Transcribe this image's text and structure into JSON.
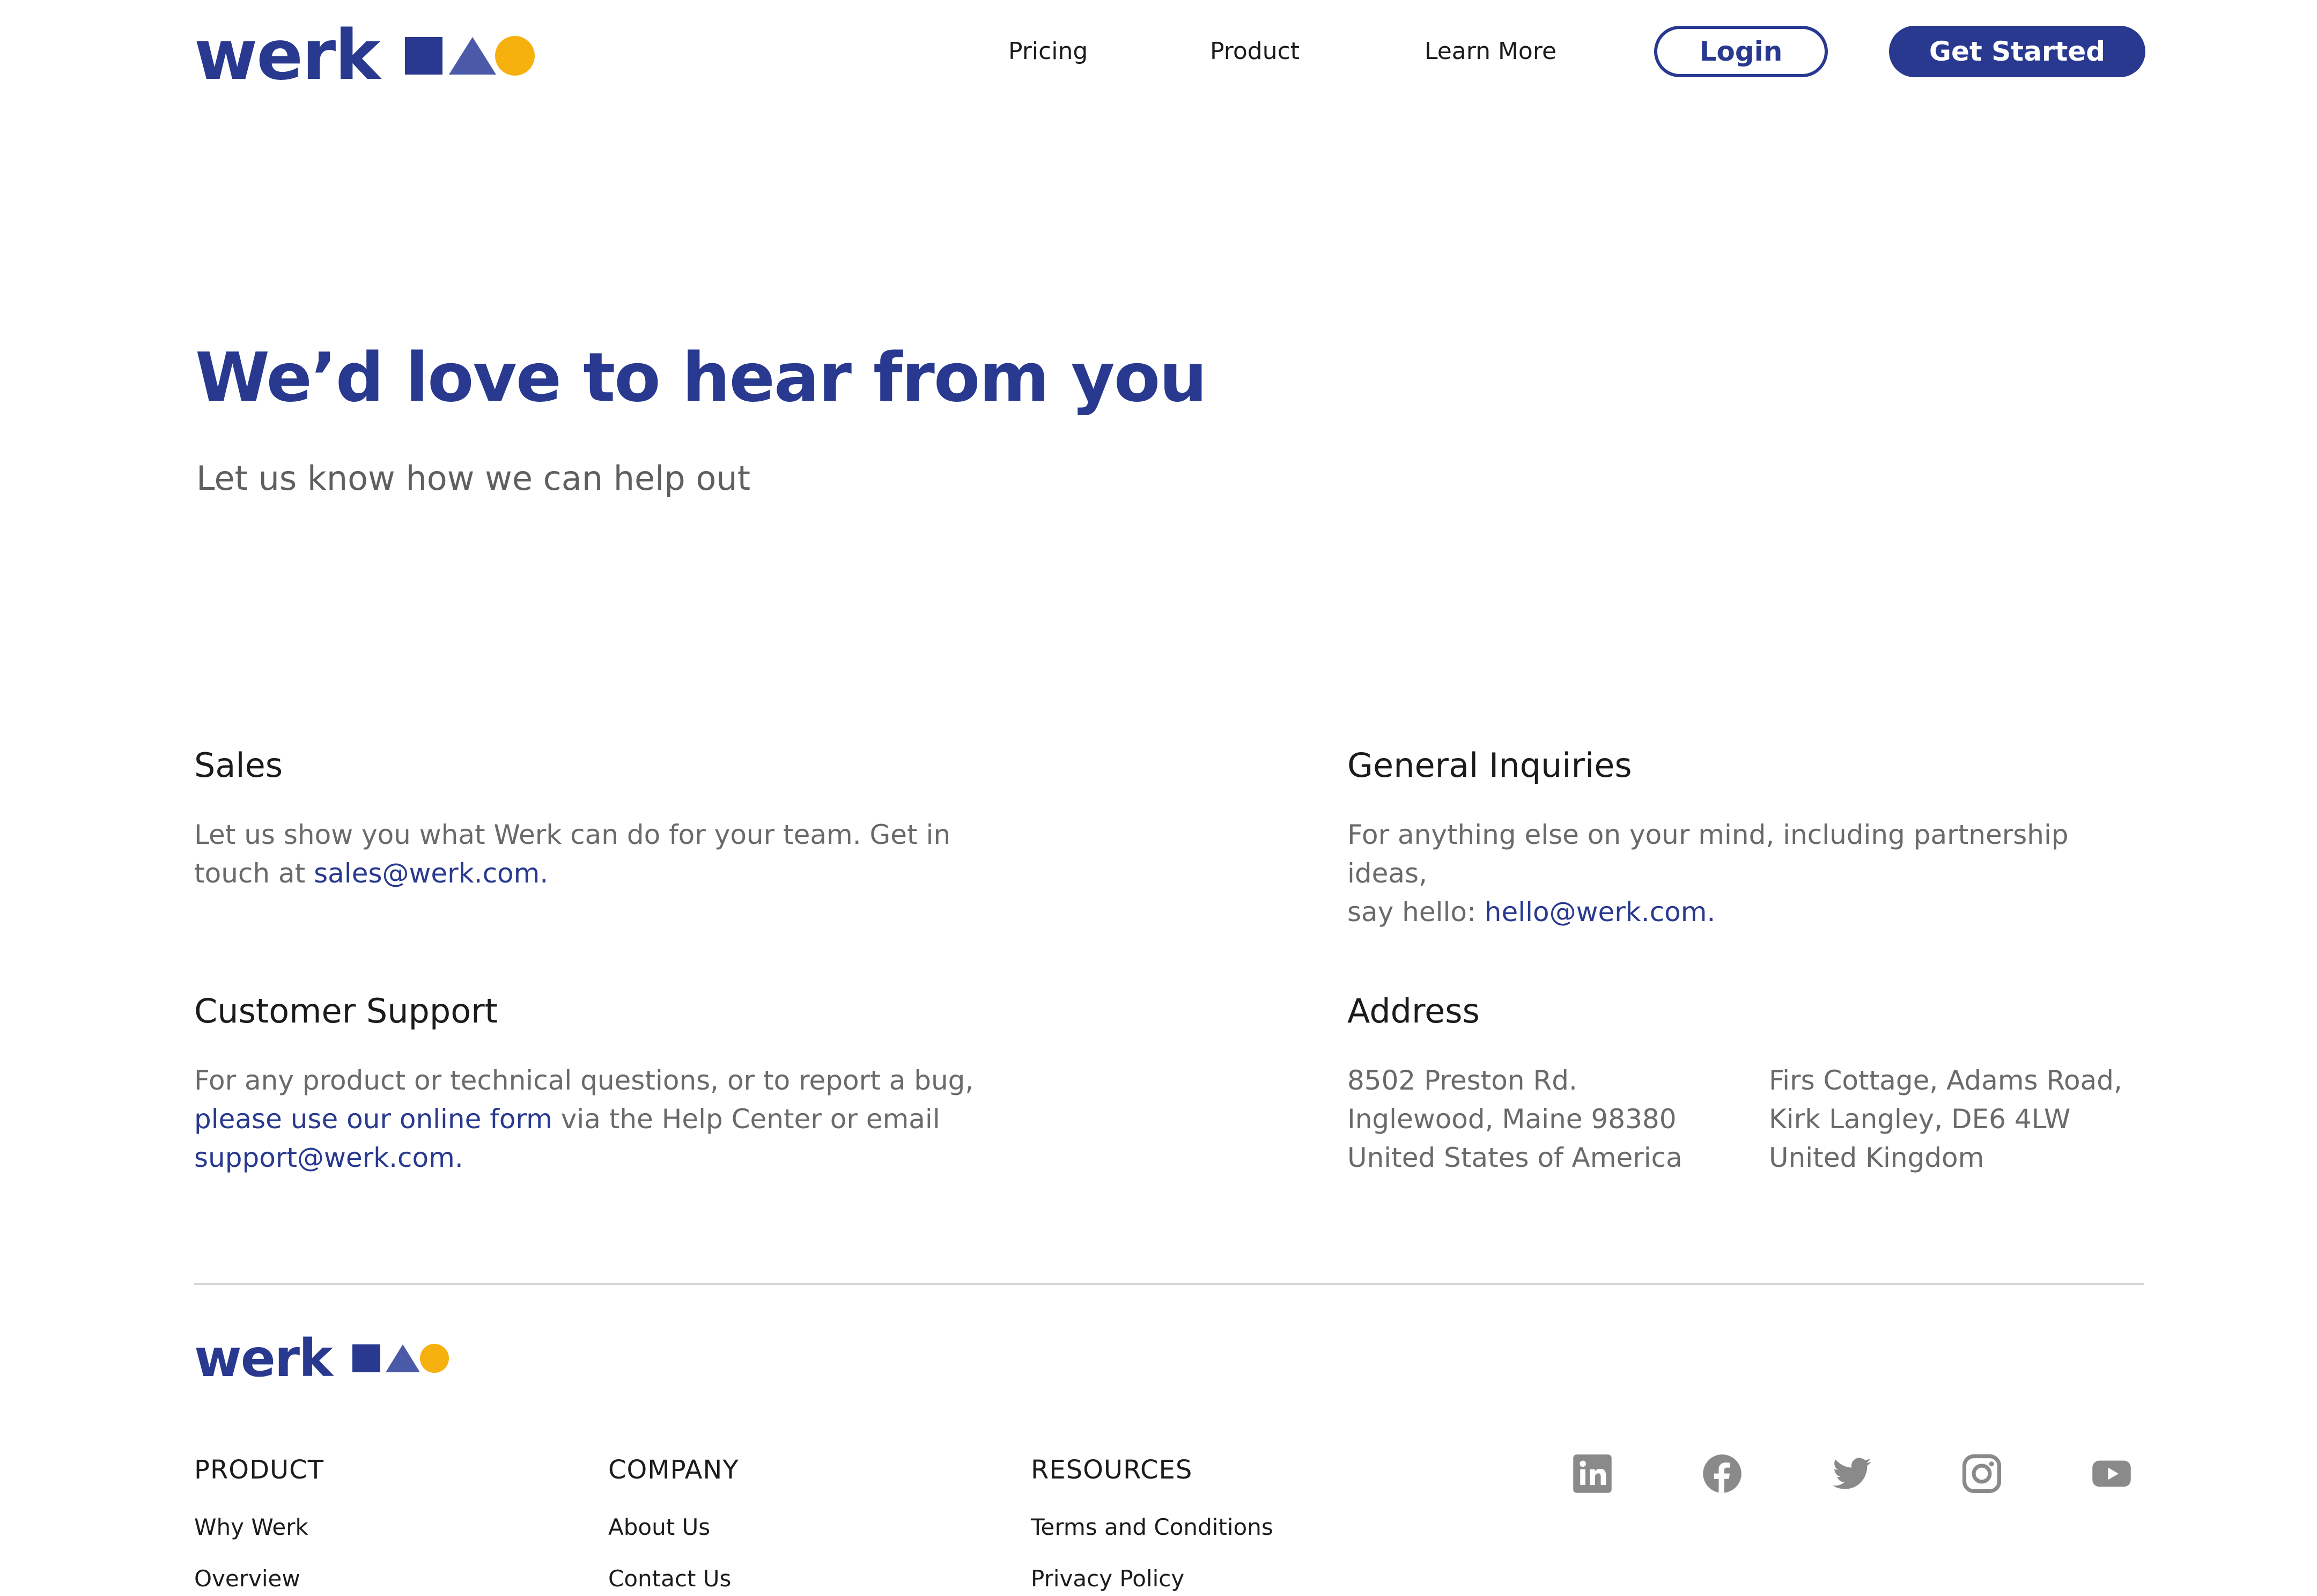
{
  "header": {
    "brand": "werk",
    "nav": [
      "Pricing",
      "Product",
      "Learn More"
    ],
    "login_label": "Login",
    "cta_label": "Get Started"
  },
  "hero": {
    "title": "We’d love to hear from you",
    "subtitle": "Let us know how we can help out"
  },
  "sections": {
    "sales": {
      "title": "Sales",
      "line1": "Let us show you what Werk can do for your team. Get in",
      "line2_prefix": "touch at ",
      "email": "sales@werk.com."
    },
    "general": {
      "title": "General Inquiries",
      "line1": "For anything else on your mind, including partnership ideas,",
      "line2_prefix": "say hello: ",
      "email": "hello@werk.com."
    },
    "support": {
      "title": "Customer Support",
      "line1": "For any product or technical questions, or to report a bug,",
      "form_link": "please use our online form",
      "line2_suffix": " via the Help Center or email",
      "email": "support@werk.com."
    },
    "address": {
      "title": "Address",
      "us": [
        "8502 Preston Rd.",
        "Inglewood, Maine 98380",
        "United States of America"
      ],
      "uk": [
        "Firs Cottage, Adams Road,",
        "Kirk Langley, DE6 4LW",
        "United Kingdom"
      ]
    }
  },
  "footer": {
    "brand": "werk",
    "columns": [
      {
        "title": "PRODUCT",
        "links": [
          "Why Werk",
          "Overview"
        ]
      },
      {
        "title": "COMPANY",
        "links": [
          "About Us",
          "Contact Us"
        ]
      },
      {
        "title": "RESOURCES",
        "links": [
          "Terms and Conditions",
          "Privacy Policy"
        ]
      }
    ],
    "social_icons": [
      "linkedin-icon",
      "facebook-icon",
      "twitter-icon",
      "instagram-icon",
      "youtube-icon"
    ]
  },
  "colors": {
    "brand_blue": "#28398f",
    "accent_yellow": "#f6b10f",
    "triangle_blue": "#4a5aa8",
    "body_gray": "#6a6a6a",
    "icon_gray": "#8a8a8a"
  }
}
